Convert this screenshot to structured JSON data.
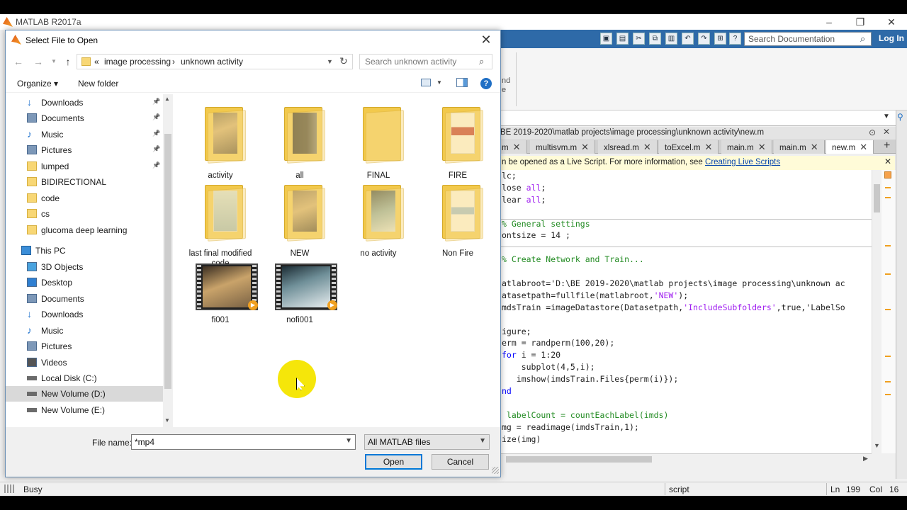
{
  "matlab": {
    "title": "MATLAB R2017a",
    "search_placeholder": "Search Documentation",
    "login": "Log In",
    "editor_path": "BE 2019-2020\\matlab projects\\image processing\\unknown activity\\new.m",
    "tabs": [
      "m",
      "multisvm.m",
      "xlsread.m",
      "toExcel.m",
      "main.m",
      "main.m",
      "new.m"
    ],
    "active_tab": "new.m",
    "info_text": "n be opened as a Live Script. For more information, see ",
    "info_link": "Creating Live Scripts",
    "code_lines": [
      "lc;",
      "lose all;",
      "lear all;",
      "",
      "% General settings",
      "ontsize = 14 ;",
      "",
      "% Create Network and Train...",
      "",
      "atlabroot='D:\\BE 2019-2020\\matlab projects\\image processing\\unknown ac",
      "atasetpath=fullfile(matlabroot,'NEW');",
      "mdsTrain =imageDatastore(Datasetpath,'IncludeSubfolders',true,'LabelSo",
      "",
      "igure;",
      "erm = randperm(100,20);",
      "for i = 1:20",
      "    subplot(4,5,i);",
      "   imshow(imdsTrain.Files{perm(i)});",
      "nd",
      "",
      " labelCount = countEachLabel(imds)",
      "mg = readimage(imdsTrain,1);",
      "ize(img)"
    ],
    "ribbon_text": [
      "nd",
      "e"
    ],
    "status": {
      "busy": "Busy",
      "mode": "script",
      "ln_label": "Ln",
      "ln": "199",
      "col_label": "Col",
      "col": "16"
    }
  },
  "dialog": {
    "title": "Select File to Open",
    "breadcrumb": {
      "prefix": "«",
      "seg1": "image processing",
      "sep": "›",
      "seg2": "unknown activity"
    },
    "search_placeholder": "Search unknown activity",
    "organize": "Organize ▾",
    "new_folder": "New folder",
    "help": "?",
    "nav_items": [
      {
        "label": "Downloads",
        "icon": "download-icon",
        "pinned": true
      },
      {
        "label": "Documents",
        "icon": "documents-icon",
        "pinned": true
      },
      {
        "label": "Music",
        "icon": "music-icon",
        "pinned": true
      },
      {
        "label": "Pictures",
        "icon": "pictures-icon",
        "pinned": true
      },
      {
        "label": "lumped",
        "icon": "folder-icon",
        "pinned": true
      },
      {
        "label": "BIDIRECTIONAL",
        "icon": "folder-icon",
        "pinned": false
      },
      {
        "label": "code",
        "icon": "folder-icon",
        "pinned": false
      },
      {
        "label": "cs",
        "icon": "folder-icon",
        "pinned": false
      },
      {
        "label": "glucoma deep learning",
        "icon": "folder-icon",
        "pinned": false
      },
      {
        "label": "This PC",
        "icon": "pc-icon",
        "pinned": false
      },
      {
        "label": "3D Objects",
        "icon": "cube-icon",
        "pinned": false
      },
      {
        "label": "Desktop",
        "icon": "desktop-icon",
        "pinned": false
      },
      {
        "label": "Documents",
        "icon": "documents-icon",
        "pinned": false
      },
      {
        "label": "Downloads",
        "icon": "download-icon",
        "pinned": false
      },
      {
        "label": "Music",
        "icon": "music-icon",
        "pinned": false
      },
      {
        "label": "Pictures",
        "icon": "pictures-icon",
        "pinned": false
      },
      {
        "label": "Videos",
        "icon": "videos-icon",
        "pinned": false
      },
      {
        "label": "Local Disk (C:)",
        "icon": "drive-icon",
        "pinned": false
      },
      {
        "label": "New Volume (D:)",
        "icon": "drive-icon",
        "pinned": false,
        "selected": true
      },
      {
        "label": "New Volume (E:)",
        "icon": "drive-icon",
        "pinned": false
      }
    ],
    "files": [
      {
        "name": "activity",
        "kind": "folder"
      },
      {
        "name": "all",
        "kind": "folder"
      },
      {
        "name": "FINAL",
        "kind": "folder"
      },
      {
        "name": "FIRE",
        "kind": "folder"
      },
      {
        "name": "last final modified code",
        "kind": "folder"
      },
      {
        "name": "NEW",
        "kind": "folder"
      },
      {
        "name": "no activity",
        "kind": "folder"
      },
      {
        "name": "Non Fire",
        "kind": "folder"
      },
      {
        "name": "fi001",
        "kind": "video"
      },
      {
        "name": "nofi001",
        "kind": "video"
      }
    ],
    "file_name_label": "File name:",
    "file_name_value": "*mp4",
    "file_type": "All MATLAB files",
    "open_label": "Open",
    "cancel_label": "Cancel"
  }
}
